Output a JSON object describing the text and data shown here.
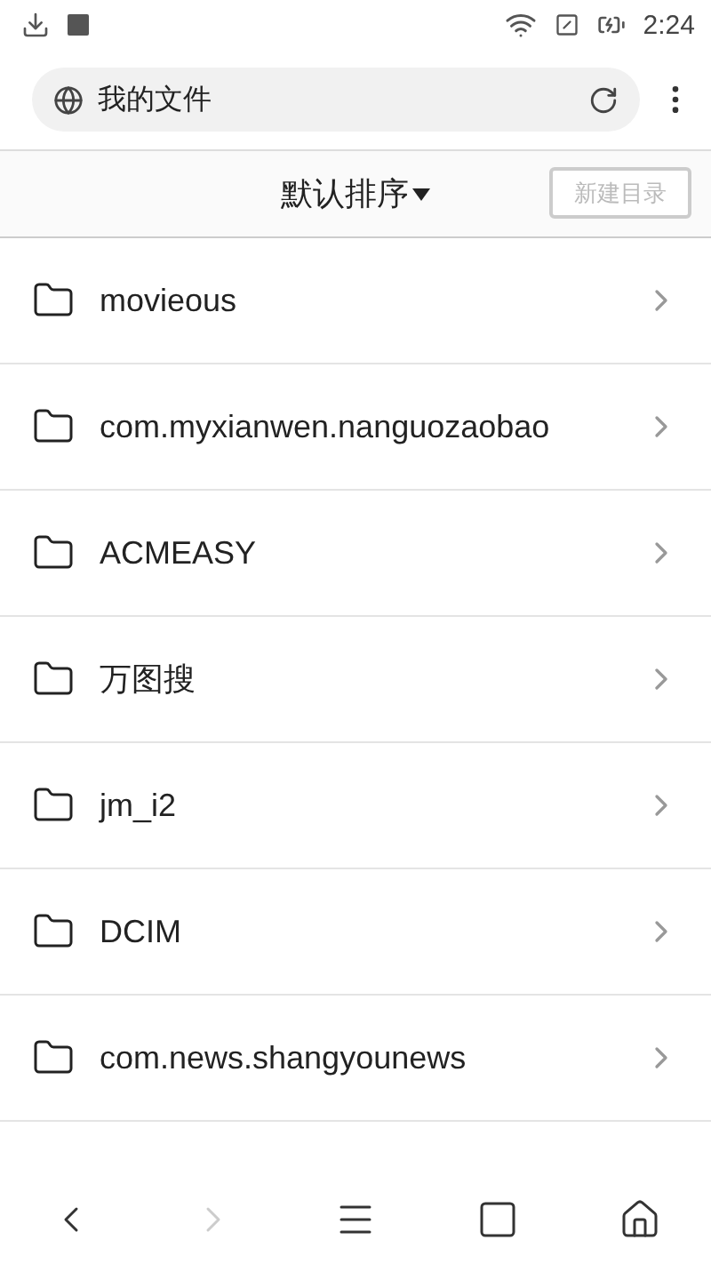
{
  "status_bar": {
    "time": "2:24"
  },
  "address_bar": {
    "title": "我的文件"
  },
  "toolbar": {
    "sort_label": "默认排序",
    "new_folder_button": {
      "label": "新建目录",
      "disabled": true
    }
  },
  "folders": [
    {
      "name": "movieous"
    },
    {
      "name": "com.myxianwen.nanguozaobao"
    },
    {
      "name": "ACMEASY"
    },
    {
      "name": "万图搜"
    },
    {
      "name": "jm_i2"
    },
    {
      "name": "DCIM"
    },
    {
      "name": "com.news.shangyounews"
    }
  ],
  "nav": [
    {
      "kind": "back",
      "disabled": false
    },
    {
      "kind": "forward",
      "disabled": true
    },
    {
      "kind": "menu",
      "disabled": false
    },
    {
      "kind": "tabs",
      "disabled": false
    },
    {
      "kind": "home",
      "disabled": false
    }
  ]
}
